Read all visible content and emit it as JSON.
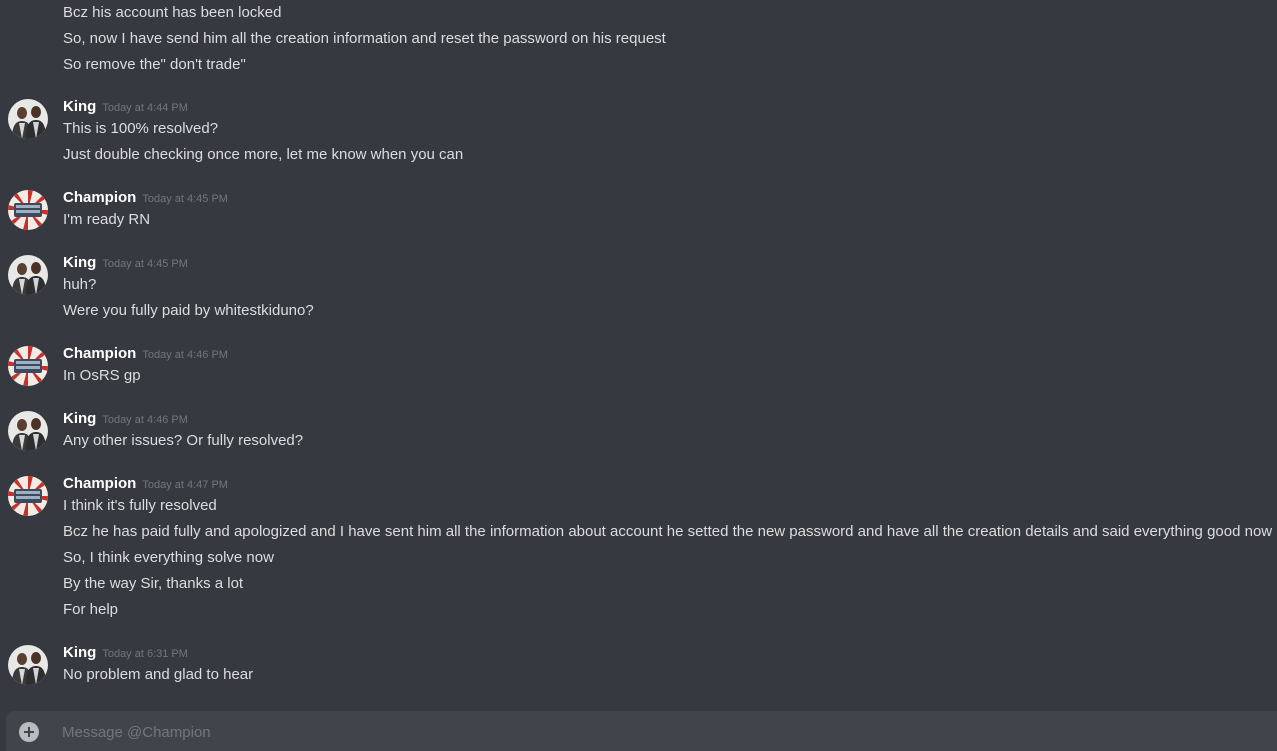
{
  "conversation": {
    "previous_lines": [
      "Bcz his account has been locked",
      "So, now I have send him all the creation information and reset the password on his request",
      "So remove the\" don't trade\""
    ],
    "groups": [
      {
        "author": "King",
        "timestamp": "Today at 4:44 PM",
        "lines": [
          "This is 100% resolved?",
          "Just double checking once more, let me know when you can"
        ]
      },
      {
        "author": "Champion",
        "timestamp": "Today at 4:45 PM",
        "lines": [
          "I'm ready RN"
        ]
      },
      {
        "author": "King",
        "timestamp": "Today at 4:45 PM",
        "lines": [
          "huh?",
          "Were you fully paid by whitestkiduno?"
        ]
      },
      {
        "author": "Champion",
        "timestamp": "Today at 4:46 PM",
        "lines": [
          "In OsRS gp"
        ]
      },
      {
        "author": "King",
        "timestamp": "Today at 4:46 PM",
        "lines": [
          "Any other issues? Or fully resolved?"
        ]
      },
      {
        "author": "Champion",
        "timestamp": "Today at 4:47 PM",
        "lines": [
          "I think it's fully resolved",
          "Bcz he has paid fully and apologized and I have sent him all the information about account he setted the new password and have all the creation details and said everything good now",
          "So, I think everything solve now",
          "By the way Sir, thanks a lot",
          "For help"
        ]
      },
      {
        "author": "King",
        "timestamp": "Today at 6:31 PM",
        "lines": [
          "No problem and glad to hear"
        ]
      }
    ]
  },
  "composer": {
    "placeholder": "Message @Champion"
  },
  "icons": {
    "king_avatar": "avatar-photo-icon",
    "champion_avatar": "sunburst-badge-icon",
    "add": "plus-circle-icon"
  },
  "colors": {
    "background": "#36393f",
    "composer": "#40444b",
    "username": "#ffffff",
    "message_text": "#dcddde",
    "timestamp": "#72767d",
    "champion_avatar_red": "#c9302c"
  }
}
